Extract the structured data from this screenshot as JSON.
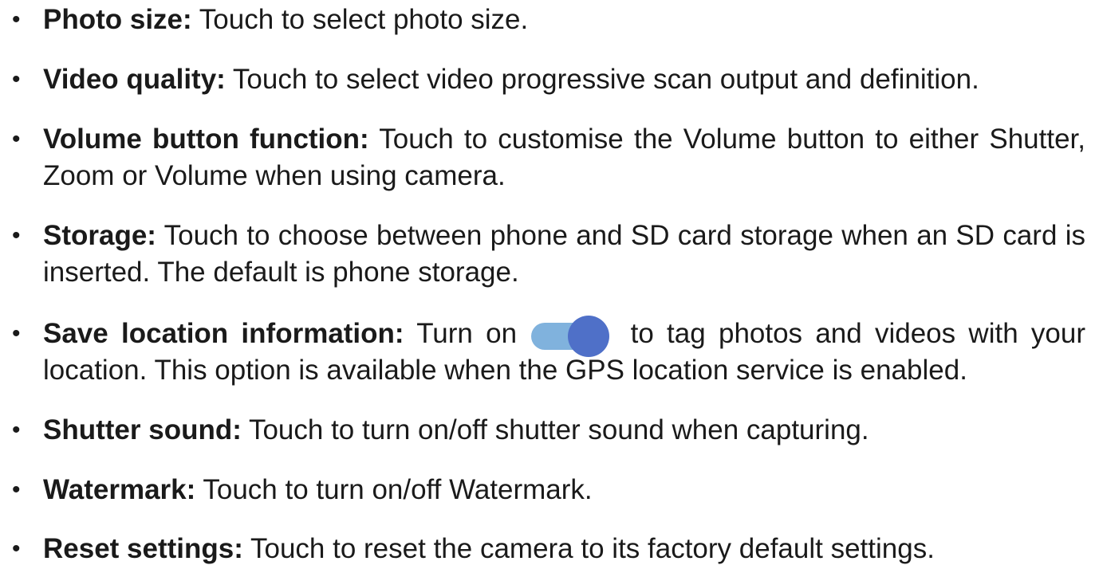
{
  "items": [
    {
      "term": "Photo size:",
      "desc": " Touch to select photo size."
    },
    {
      "term": "Video quality:",
      "desc": " Touch to select video progressive scan output and definition."
    },
    {
      "term": "Volume button function:",
      "desc": " Touch to customise the Volume button to either Shutter, Zoom or Volume when using camera."
    },
    {
      "term": "Storage:",
      "desc": " Touch to choose between phone and SD card storage when an SD card is inserted. The default is phone storage."
    },
    {
      "term": "Save location information:",
      "desc_before": " Turn on ",
      "desc_after": " to tag photos and videos with your location. This option is available when the GPS location service is enabled.",
      "toggle_state": "on"
    },
    {
      "term": "Shutter sound:",
      "desc": " Touch to turn on/off shutter sound when capturing."
    },
    {
      "term": "Watermark:",
      "desc": " Touch to turn on/off Watermark."
    },
    {
      "term": "Reset settings:",
      "desc": " Touch to reset the camera to its factory default settings."
    }
  ],
  "bullet": "•",
  "colors": {
    "text": "#1a1a1a",
    "toggle_track": "#80b2dd",
    "toggle_knob": "#4f70c8"
  },
  "icons": {
    "toggle": "switch-toggle-icon"
  }
}
